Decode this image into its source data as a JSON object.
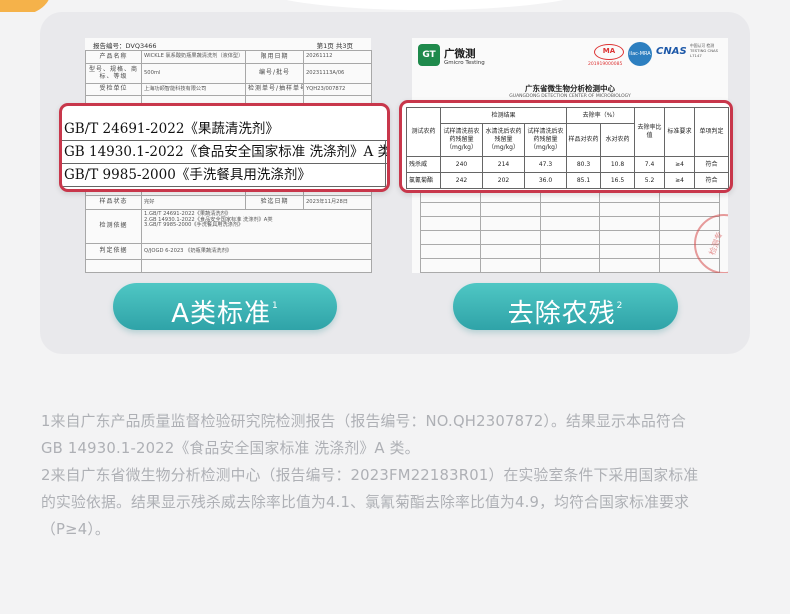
{
  "left_report": {
    "report_no": "报告编号：DVQ3466",
    "page": "第1页 共3页",
    "rows": [
      [
        "产品名称",
        "WICKLE 氯系酸奶瓶果蔬清洗剂（液体型）",
        "限用日期",
        "20261112"
      ],
      [
        "型号、规格、商标、等级",
        "500ml",
        "编号/批号",
        "20231113A/06"
      ],
      [
        "受检单位",
        "上海功颉智能科技有限公司",
        "检测单号/抽样单号",
        "YQH23/007872"
      ]
    ],
    "rows_bottom": [
      [
        "",
        "",
        "日期",
        "2023年11月16日"
      ],
      [
        "样品状态",
        "完好",
        "验迄日期",
        "2023年11月28日"
      ]
    ],
    "basis_label": "检测依据",
    "basis_lines": [
      "1.GB/T 24691-2022《果蔬清洗剂》",
      "2.GB 14930.1-2022《食品安全国家标准 洗涤剂》A类",
      "3.GB/T 9985-2000《手洗餐具用洗涤剂》"
    ],
    "judge_label": "判定依据",
    "judge_value": "Q/JOGD 6-2023 《奶瓶果蔬清洗剂》",
    "callout": [
      "GB/T 24691-2022《果蔬清洗剂》",
      "GB 14930.1-2022《食品安全国家标准  洗涤剂》A 类",
      "GB/T 9985-2000《手洗餐具用洗涤剂》"
    ]
  },
  "right_report": {
    "logo_text": "GT",
    "brand": "广微测",
    "brand_en": "Gmicro Testing",
    "ma": "MA",
    "ma_no": "201919000085",
    "ilac": "ilac-MRA",
    "cnas": "CNAS",
    "cnas_small": "中国认可 检测 TESTING CNAS L7147",
    "title": "广东省微生物分析检测中心",
    "title_en": "GUANGDONG DETECTION CENTER OF MICROBIOLOGY",
    "stamp_text": "检测专",
    "table": {
      "col_pesticide": "测试农药",
      "group_results": "检测结果",
      "group_rate": "去除率（%）",
      "sub_headers": [
        "试样清洗前农药残留量（mg/kg）",
        "水清洗后农药残留量（mg/kg）",
        "试样清洗后农药残留量（mg/kg）",
        "样品对农药",
        "水对农药"
      ],
      "col_ratio": "去除率比值",
      "col_std": "标准要求",
      "col_judge": "单项判定",
      "rows": [
        [
          "残杀威",
          "240",
          "214",
          "47.3",
          "80.3",
          "10.8",
          "7.4",
          "≥4",
          "符合"
        ],
        [
          "氯氰菊酯",
          "242",
          "202",
          "36.0",
          "85.1",
          "16.5",
          "5.2",
          "≥4",
          "符合"
        ]
      ]
    }
  },
  "pills": {
    "left_label": "A类标准",
    "left_sup": "1",
    "right_label": "去除农残",
    "right_sup": "2"
  },
  "notes": [
    "1来自广东产品质量监督检验研究院检测报告（报告编号：NO.QH2307872）。结果显示本品符合",
    "GB 14930.1-2022《食品安全国家标准 洗涤剂》A 类。",
    "2来自广东省微生物分析检测中心（报告编号：2023FM22183R01）在实验室条件下采用国家标准",
    "的实验依据。结果显示残杀威去除率比值为4.1、氯氰菊酯去除率比值为4.9，均符合国家标准要求",
    "（P≥4）。"
  ],
  "colors": {
    "accent_teal": "#2fa3a8",
    "callout_red": "#c8374b",
    "note_gray": "#aeb0b5"
  }
}
